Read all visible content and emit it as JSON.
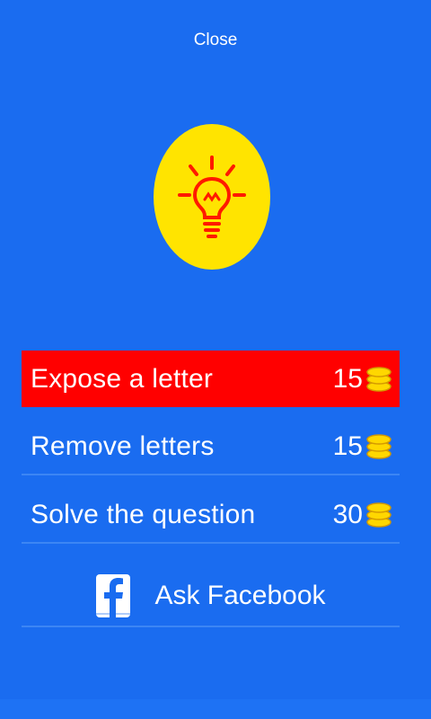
{
  "header": {
    "close_label": "Close"
  },
  "hint": {
    "icon": "lightbulb-icon",
    "circle_color": "#ffe400",
    "icon_color": "#ff1a00"
  },
  "options": [
    {
      "label": "Expose a letter",
      "cost": "15",
      "icon": "coins-icon",
      "highlighted": true
    },
    {
      "label": "Remove letters",
      "cost": "15",
      "icon": "coins-icon",
      "highlighted": false
    },
    {
      "label": "Solve the question",
      "cost": "30",
      "icon": "coins-icon",
      "highlighted": false
    }
  ],
  "facebook": {
    "label": "Ask Facebook",
    "icon": "facebook-icon"
  },
  "colors": {
    "background": "#1a6cf0",
    "highlight": "#ff0000",
    "coin": "#ffd700"
  }
}
